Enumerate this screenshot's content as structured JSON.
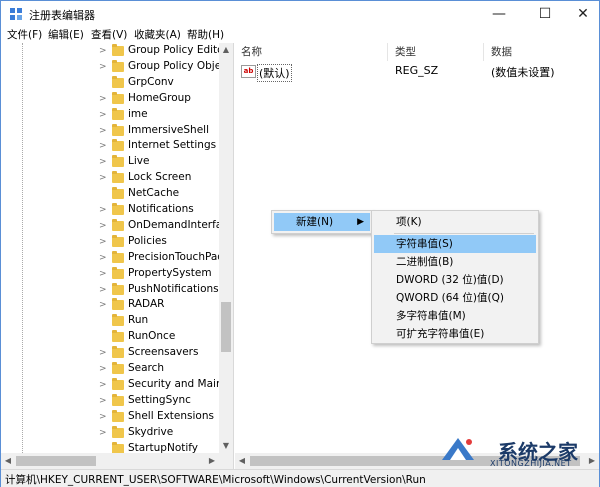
{
  "window": {
    "title": "注册表编辑器",
    "minimize": "—",
    "maximize": "☐",
    "close": "✕"
  },
  "menu": [
    "文件(F)",
    "编辑(E)",
    "查看(V)",
    "收藏夹(A)",
    "帮助(H)"
  ],
  "tree": {
    "items": [
      {
        "label": "Group Policy Editor",
        "expandable": true
      },
      {
        "label": "Group Policy Objec",
        "expandable": true
      },
      {
        "label": "GrpConv",
        "expandable": false
      },
      {
        "label": "HomeGroup",
        "expandable": true
      },
      {
        "label": "ime",
        "expandable": true
      },
      {
        "label": "ImmersiveShell",
        "expandable": true
      },
      {
        "label": "Internet Settings",
        "expandable": true
      },
      {
        "label": "Live",
        "expandable": true
      },
      {
        "label": "Lock Screen",
        "expandable": true
      },
      {
        "label": "NetCache",
        "expandable": false
      },
      {
        "label": "Notifications",
        "expandable": true
      },
      {
        "label": "OnDemandInterface",
        "expandable": true
      },
      {
        "label": "Policies",
        "expandable": true
      },
      {
        "label": "PrecisionTouchPad",
        "expandable": true
      },
      {
        "label": "PropertySystem",
        "expandable": true
      },
      {
        "label": "PushNotifications",
        "expandable": true
      },
      {
        "label": "RADAR",
        "expandable": true
      },
      {
        "label": "Run",
        "expandable": false
      },
      {
        "label": "RunOnce",
        "expandable": false
      },
      {
        "label": "Screensavers",
        "expandable": true
      },
      {
        "label": "Search",
        "expandable": true
      },
      {
        "label": "Security and Mainte",
        "expandable": true
      },
      {
        "label": "SettingSync",
        "expandable": true
      },
      {
        "label": "Shell Extensions",
        "expandable": true
      },
      {
        "label": "Skydrive",
        "expandable": true
      },
      {
        "label": "StartupNotify",
        "expandable": false
      }
    ]
  },
  "list": {
    "columns": [
      "名称",
      "类型",
      "数据"
    ],
    "rows": [
      {
        "name": "(默认)",
        "type": "REG_SZ",
        "data": "(数值未设置)",
        "icon": "ab"
      }
    ]
  },
  "context_menu": {
    "parent": "新建(N)",
    "submenu": [
      "项(K)",
      "字符串值(S)",
      "二进制值(B)",
      "DWORD (32 位)值(D)",
      "QWORD (64 位)值(Q)",
      "多字符串值(M)",
      "可扩充字符串值(E)"
    ],
    "highlighted": "字符串值(S)"
  },
  "status": "计算机\\HKEY_CURRENT_USER\\SOFTWARE\\Microsoft\\Windows\\CurrentVersion\\Run",
  "watermark": {
    "text": "系统之家",
    "sub": "XITONGZHIJIA.NET"
  },
  "colors": {
    "highlight": "#91c9f7",
    "folder": "#f0c64b",
    "border": "#5a8fd6"
  }
}
